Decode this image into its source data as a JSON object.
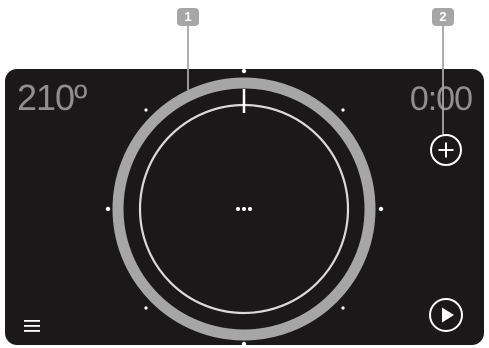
{
  "callouts": [
    {
      "label": "1"
    },
    {
      "label": "2"
    }
  ],
  "display": {
    "temperature": "210º",
    "timer": "0:00",
    "center_indicator": "..."
  },
  "controls": {
    "add_icon": "plus-circle-icon",
    "play_icon": "play-circle-icon",
    "menu_icon": "hamburger-menu-icon"
  },
  "colors": {
    "panel_background": "#1a1818",
    "callout_background": "#a6a6a6",
    "ring_outer": "#a6a6a6",
    "ring_inner": "#d9d9d9",
    "text": "#8f8f8f",
    "icon": "#ffffff"
  }
}
